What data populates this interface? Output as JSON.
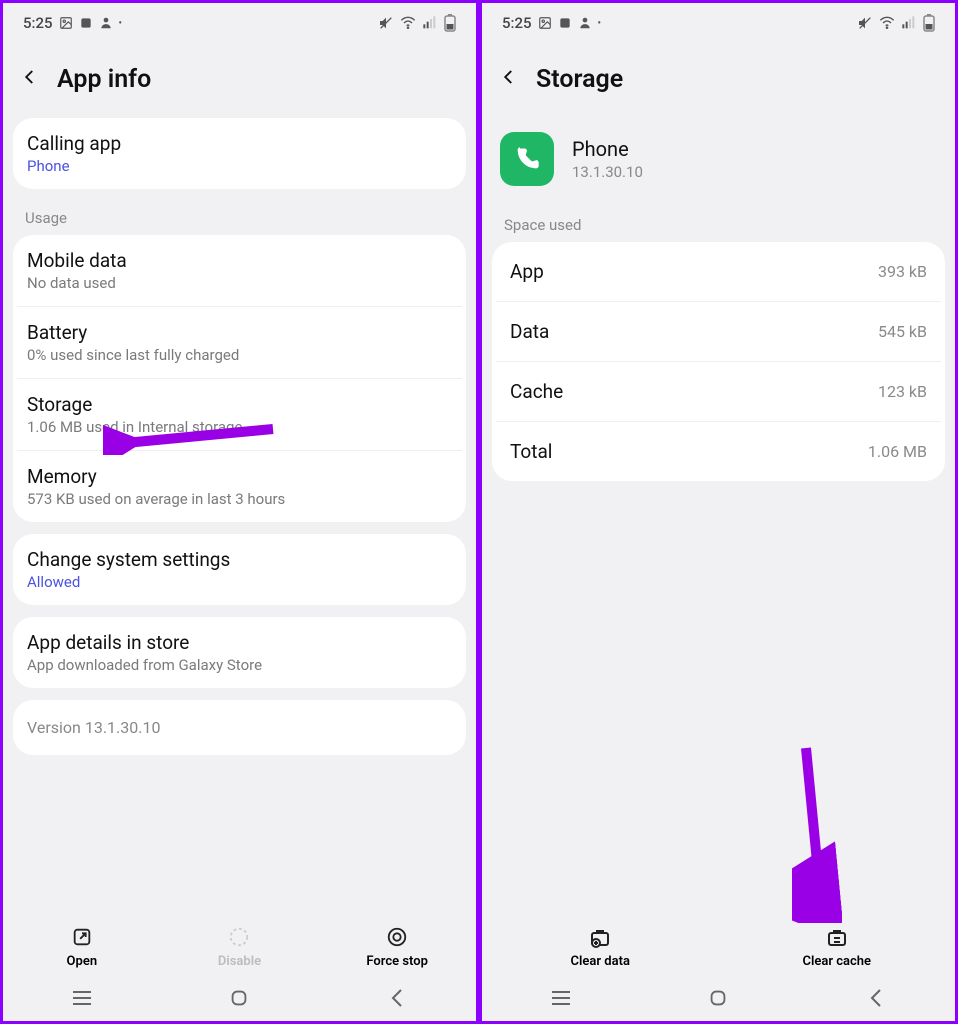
{
  "status": {
    "time": "5:25",
    "icons_left": [
      "image-icon",
      "clock-icon",
      "person-icon",
      "dot"
    ],
    "icons_right": [
      "mute-icon",
      "wifi-icon",
      "signal-icon",
      "battery-icon"
    ]
  },
  "left": {
    "title": "App info",
    "calling": {
      "title": "Calling app",
      "value": "Phone"
    },
    "usage_label": "Usage",
    "items": {
      "mobile": {
        "title": "Mobile data",
        "sub": "No data used"
      },
      "battery": {
        "title": "Battery",
        "sub": "0% used since last fully charged"
      },
      "storage": {
        "title": "Storage",
        "sub": "1.06 MB used in Internal storage"
      },
      "memory": {
        "title": "Memory",
        "sub": "573 KB used on average in last 3 hours"
      }
    },
    "system": {
      "title": "Change system settings",
      "value": "Allowed"
    },
    "store": {
      "title": "App details in store",
      "sub": "App downloaded from Galaxy Store"
    },
    "version": "Version 13.1.30.10",
    "actions": {
      "open": "Open",
      "disable": "Disable",
      "forcestop": "Force stop"
    }
  },
  "right": {
    "title": "Storage",
    "app": {
      "name": "Phone",
      "version": "13.1.30.10"
    },
    "space_label": "Space used",
    "rows": {
      "app": {
        "k": "App",
        "v": "393 kB"
      },
      "data": {
        "k": "Data",
        "v": "545 kB"
      },
      "cache": {
        "k": "Cache",
        "v": "123 kB"
      },
      "total": {
        "k": "Total",
        "v": "1.06 MB"
      }
    },
    "actions": {
      "cleardata": "Clear data",
      "clearcache": "Clear cache"
    }
  }
}
